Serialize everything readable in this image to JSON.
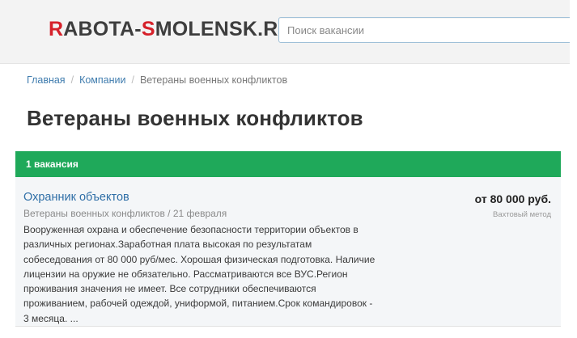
{
  "header": {
    "logo_part1": "R",
    "logo_part2": "ABOTA-",
    "logo_part3": "S",
    "logo_part4": "MOLENSK.RU",
    "search_placeholder": "Поиск вакансии"
  },
  "breadcrumb": {
    "items": [
      "Главная",
      "Компании",
      "Ветераны военных конфликтов"
    ],
    "separator": "/"
  },
  "page": {
    "title": "Ветераны военных конфликтов"
  },
  "results": {
    "count_label": "1 вакансия"
  },
  "vacancies": [
    {
      "title": "Охранник объектов",
      "meta": "Ветераны военных конфликтов / 21 февраля",
      "description": "Вооруженная охрана и обеспечение безопасности территории объектов в различных регионах.Заработная плата высокая по результатам собеседования от 80 000 руб/мес. Хорошая физическая подготовка. Наличие лицензии на оружие не обязательно. Рассматриваются все ВУС.Регион проживания значения не имеет. Все сотрудники обеспечиваются проживанием, рабочей одеждой, униформой, питанием.Срок командировок - 3 месяца. ...",
      "salary": "от 80 000 руб.",
      "schedule": "Вахтовый метод"
    }
  ],
  "colors": {
    "logo_red": "#d6212a",
    "logo_dark": "#3d3d3d",
    "link_blue": "#2f6fa7",
    "bar_green": "#1fa95a"
  }
}
